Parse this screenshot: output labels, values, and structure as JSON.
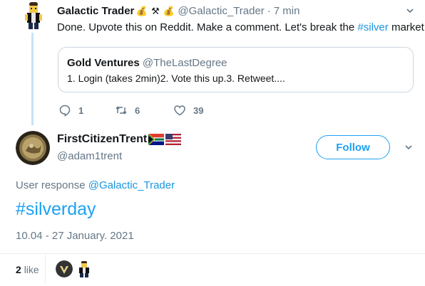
{
  "parent_tweet": {
    "display_name": "Galactic Trader",
    "emojis": [
      "money-bag-icon",
      "hammer-pick-icon",
      "money-bag-icon"
    ],
    "handle": "@Galactic_Trader",
    "separator": "·",
    "time": "7 min",
    "text_before": "Done. Upvote this on Reddit. Make a comment. Let's break the ",
    "text_hashtag": "#silver",
    "text_after": " market.",
    "quote": {
      "display_name": "Gold Ventures",
      "handle": "@TheLastDegree",
      "text": "1. Login (takes 2min)2. Vote this up.3. Retweet...."
    },
    "actions": {
      "replies": "1",
      "retweets": "6",
      "likes": "39"
    }
  },
  "main_tweet": {
    "display_name": "FirstCitizenTrent",
    "flags": [
      "south-africa-flag-icon",
      "usa-flag-icon"
    ],
    "handle": "@adam1trent",
    "follow_label": "Follow",
    "reply_prefix": "User response",
    "reply_to": "@Galactic_Trader",
    "text": "#silverday",
    "timestamp": "10.04 - 27 January. 2021",
    "likes_count": "2",
    "likes_label": "like"
  },
  "colors": {
    "link": "#1da1f2",
    "muted": "#657786",
    "thread": "#c4e4f8",
    "border": "#ccd6dd"
  }
}
